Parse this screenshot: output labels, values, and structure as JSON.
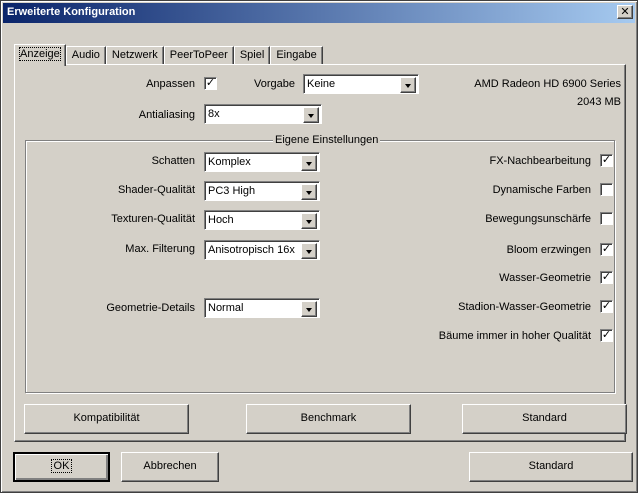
{
  "window": {
    "title": "Erweiterte Konfiguration",
    "close_glyph": "✕"
  },
  "tabs": [
    "Anzeige",
    "Audio",
    "Netzwerk",
    "PeerToPeer",
    "Spiel",
    "Eingabe"
  ],
  "top": {
    "anpassen_label": "Anpassen",
    "anpassen_checked": true,
    "vorgabe_label": "Vorgabe",
    "vorgabe_value": "Keine",
    "antialiasing_label": "Antialiasing",
    "antialiasing_value": "8x",
    "gpu_name": "AMD Radeon HD 6900 Series",
    "gpu_memory": "2043 MB"
  },
  "group": {
    "title": "Eigene Einstellungen",
    "combos": [
      {
        "label": "Schatten",
        "value": "Komplex"
      },
      {
        "label": "Shader-Qualität",
        "value": "PC3 High"
      },
      {
        "label": "Texturen-Qualität",
        "value": "Hoch"
      },
      {
        "label": "Max. Filterung",
        "value": "Anisotropisch 16x"
      },
      {
        "label": "Geometrie-Details",
        "value": "Normal"
      }
    ],
    "checks": [
      {
        "label": "FX-Nachbearbeitung",
        "checked": true
      },
      {
        "label": "Dynamische Farben",
        "checked": false
      },
      {
        "label": "Bewegungsunschärfe",
        "checked": false
      },
      {
        "label": "Bloom erzwingen",
        "checked": true
      },
      {
        "label": "Wasser-Geometrie",
        "checked": true
      },
      {
        "label": "Stadion-Wasser-Geometrie",
        "checked": true
      },
      {
        "label": "Bäume immer in hoher Qualität",
        "checked": true
      }
    ]
  },
  "panel_buttons": {
    "compat": "Kompatibilität",
    "benchmark": "Benchmark",
    "standard": "Standard"
  },
  "footer": {
    "ok": "OK",
    "cancel": "Abbrechen",
    "standard": "Standard"
  },
  "checkmark_glyph": "✓"
}
